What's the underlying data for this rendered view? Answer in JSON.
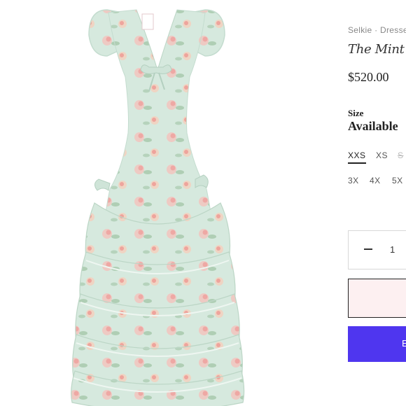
{
  "product": {
    "breadcrumb": "Selkie · Dresses",
    "title": "The Mint Jo",
    "price": "$520.00"
  },
  "size": {
    "label": "Size",
    "status": "Available",
    "options": [
      {
        "label": "XXS",
        "state": "selected"
      },
      {
        "label": "XS",
        "state": "available"
      },
      {
        "label": "S",
        "state": "sold-out"
      },
      {
        "label": "3X",
        "state": "available"
      },
      {
        "label": "4X",
        "state": "available"
      },
      {
        "label": "5X",
        "state": "available"
      }
    ]
  },
  "quantity": {
    "value": "1"
  },
  "cart_button": {
    "label": "E"
  },
  "colors": {
    "dress": "#d4e7dc",
    "flowers": "#f2b9b4",
    "wishlist_bg": "#fdf0f1",
    "cart_bg": "#4f36ef"
  }
}
